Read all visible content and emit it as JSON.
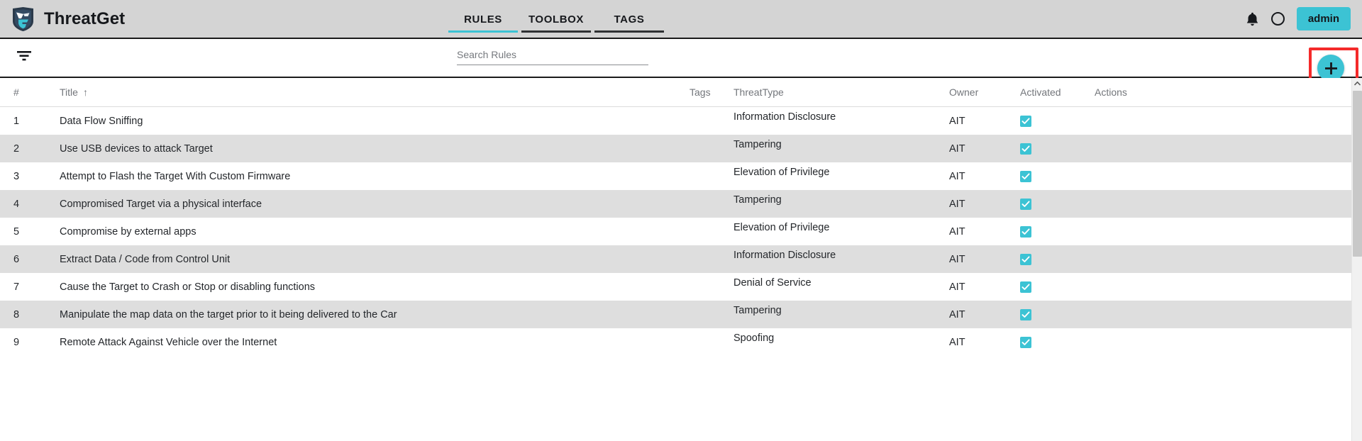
{
  "app": {
    "brand_name": "ThreatGet",
    "accent_color": "#3cc3d4",
    "highlight_color": "#f42a2a",
    "appbar_bg": "#d4d4d4"
  },
  "nav": {
    "tabs": [
      {
        "label": "RULES",
        "active": true
      },
      {
        "label": "TOOLBOX",
        "active": false
      },
      {
        "label": "TAGS",
        "active": false
      }
    ]
  },
  "appbar_right": {
    "bell_icon": "bell-icon",
    "avatar_icon": "avatar-circle-icon",
    "admin_label": "admin"
  },
  "toolbar": {
    "filter_icon": "filter-icon",
    "search": {
      "placeholder": "Search Rules",
      "value": "",
      "icon": "search-icon"
    },
    "add_button": {
      "icon": "plus-icon",
      "highlighted": true
    }
  },
  "table": {
    "columns": [
      {
        "key": "num",
        "label": "#"
      },
      {
        "key": "title",
        "label": "Title",
        "sort": "↑"
      },
      {
        "key": "tags",
        "label": "Tags"
      },
      {
        "key": "type",
        "label": "ThreatType"
      },
      {
        "key": "owner",
        "label": "Owner"
      },
      {
        "key": "act",
        "label": "Activated"
      },
      {
        "key": "actions",
        "label": "Actions"
      }
    ],
    "rows": [
      {
        "num": "1",
        "title": "Data Flow Sniffing",
        "tags": "",
        "type": "Information Disclosure",
        "owner": "AIT",
        "activated": true
      },
      {
        "num": "2",
        "title": "Use USB devices to attack Target",
        "tags": "",
        "type": "Tampering",
        "owner": "AIT",
        "activated": true
      },
      {
        "num": "3",
        "title": "Attempt to Flash the Target With Custom Firmware",
        "tags": "",
        "type": "Elevation of Privilege",
        "owner": "AIT",
        "activated": true
      },
      {
        "num": "4",
        "title": "Compromised Target via a physical interface",
        "tags": "",
        "type": "Tampering",
        "owner": "AIT",
        "activated": true
      },
      {
        "num": "5",
        "title": "Compromise by external apps",
        "tags": "",
        "type": "Elevation of Privilege",
        "owner": "AIT",
        "activated": true
      },
      {
        "num": "6",
        "title": "Extract Data / Code from Control Unit",
        "tags": "",
        "type": "Information Disclosure",
        "owner": "AIT",
        "activated": true
      },
      {
        "num": "7",
        "title": "Cause the Target to Crash or Stop or disabling functions",
        "tags": "",
        "type": "Denial of Service",
        "owner": "AIT",
        "activated": true
      },
      {
        "num": "8",
        "title": "Manipulate the map data on the target prior to it being delivered to the Car",
        "tags": "",
        "type": "Tampering",
        "owner": "AIT",
        "activated": true
      },
      {
        "num": "9",
        "title": "Remote Attack Against Vehicle over the Internet",
        "tags": "",
        "type": "Spoofing",
        "owner": "AIT",
        "activated": true
      }
    ]
  },
  "scrollbar": {
    "up_arrow_icon": "chevron-up-icon"
  }
}
